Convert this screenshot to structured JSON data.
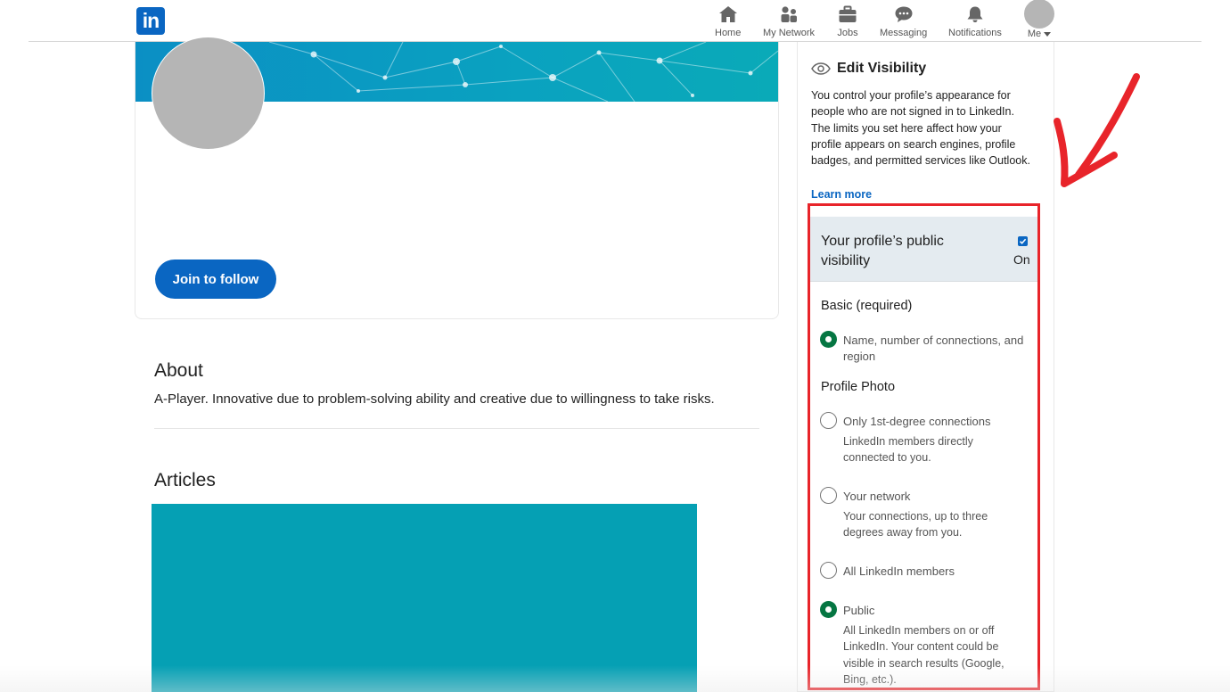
{
  "nav": {
    "logo_text": "in",
    "items": [
      {
        "label": "Home",
        "icon": "home-icon"
      },
      {
        "label": "My Network",
        "icon": "network-icon"
      },
      {
        "label": "Jobs",
        "icon": "briefcase-icon"
      },
      {
        "label": "Messaging",
        "icon": "messaging-icon"
      },
      {
        "label": "Notifications",
        "icon": "bell-icon"
      }
    ],
    "me_label": "Me"
  },
  "profile": {
    "join_label": "Join to follow"
  },
  "about": {
    "title": "About",
    "text": "A-Player. Innovative due to problem-solving ability and creative due to willingness to take risks."
  },
  "articles": {
    "title": "Articles"
  },
  "edit_visibility": {
    "title": "Edit Visibility",
    "description": "You control your profile’s appearance for people who are not signed in to LinkedIn. The limits you set here affect how your profile appears on search engines, profile badges, and permitted services like Outlook.",
    "learn_more": "Learn more",
    "public_visibility": {
      "title": "Your profile’s public visibility",
      "checked": true,
      "state": "On"
    },
    "basic": {
      "label": "Basic (required)",
      "option": "Name, number of connections, and region"
    },
    "profile_photo": {
      "label": "Profile Photo",
      "options": [
        {
          "label": "Only 1st-degree connections",
          "desc": "LinkedIn members directly connected to you.",
          "selected": false
        },
        {
          "label": "Your network",
          "desc": "Your connections, up to three degrees away from you.",
          "selected": false
        },
        {
          "label": "All LinkedIn members",
          "desc": "",
          "selected": false
        },
        {
          "label": "Public",
          "desc": "All LinkedIn members on or off LinkedIn. Your content could be visible in search results (Google, Bing, etc.).",
          "selected": true
        }
      ]
    }
  },
  "colors": {
    "brand": "#0a66c2",
    "selected_radio": "#057642",
    "annotation": "#e8242a"
  }
}
